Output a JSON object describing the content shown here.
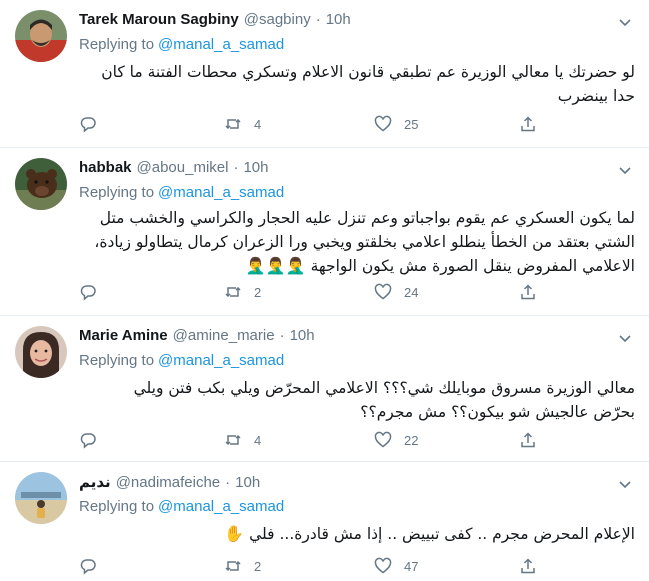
{
  "tweets": [
    {
      "name": "Tarek Maroun Sagbiny",
      "handle": "@sagbiny",
      "time": "10h",
      "replying_prefix": "Replying to",
      "replying_to": "@manal_a_samad",
      "text_lines": [
        "لو حضرتك يا معالي الوزيرة عم تطبقي قانون الاعلام وتسكري محطات الفتنة ما كان",
        "حدا بينضرب"
      ],
      "emoji": "",
      "retweets": "4",
      "likes": "25"
    },
    {
      "name": "habbak",
      "handle": "@abou_mikel",
      "time": "10h",
      "replying_prefix": "Replying to",
      "replying_to": "@manal_a_samad",
      "text_lines": [
        "لما يكون العسكري عم يقوم بواجباتو وعم تنزل عليه الحجار والكراسي والخشب متل",
        "الشتي بعتقد من الخطأ ينطلو اعلامي بخلقتو ويخبي ورا الزعران كرمال يتطاولو زيادة،",
        "الاعلامي المفروض ينقل الصورة مش يكون الواجهة"
      ],
      "emoji": "🤦‍♂️🤦‍♂️🤦‍♂️",
      "retweets": "2",
      "likes": "24"
    },
    {
      "name": "Marie Amine",
      "handle": "@amine_marie",
      "time": "10h",
      "replying_prefix": "Replying to",
      "replying_to": "@manal_a_samad",
      "text_lines": [
        "معالي الوزيرة مسروق موبايلك شي؟؟؟ الاعلامي المحرّض ويلي بكب فتن ويلي",
        "بحرّض عالجيش شو بيكون؟؟ مش مجرم؟؟"
      ],
      "emoji": "",
      "retweets": "4",
      "likes": "22"
    },
    {
      "name": "نديم",
      "handle": "@nadimafeiche",
      "time": "10h",
      "replying_prefix": "Replying to",
      "replying_to": "@manal_a_samad",
      "text_lines": [
        "الإعلام المحرض  مجرم .. كفى  تبييض .. إذا مش قادرة... فلي"
      ],
      "emoji": "✋",
      "retweets": "2",
      "likes": "47"
    }
  ]
}
